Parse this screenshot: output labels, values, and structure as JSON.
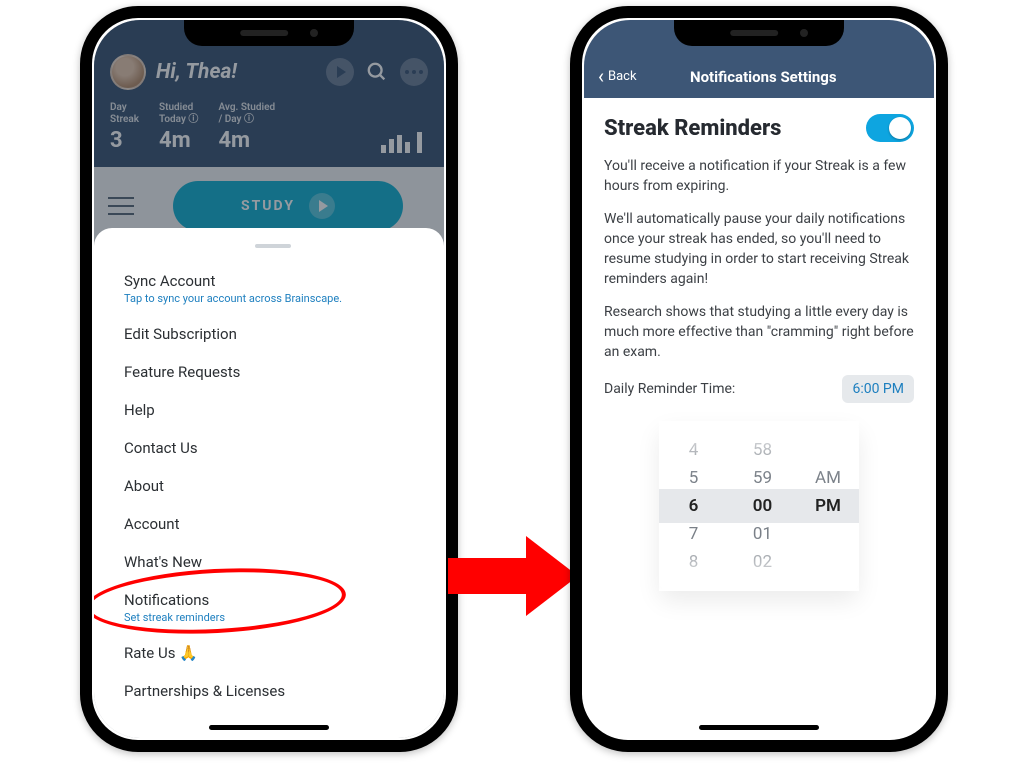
{
  "left": {
    "greeting": "Hi, Thea!",
    "stats": [
      {
        "label": "Day\nStreak",
        "value": "3"
      },
      {
        "label": "Studied\nToday ⓘ",
        "value": "4m"
      },
      {
        "label": "Avg. Studied\n/ Day ⓘ",
        "value": "4m"
      }
    ],
    "study_button": "STUDY",
    "menu": {
      "sync_title": "Sync Account",
      "sync_sub": "Tap to sync your account across Brainscape.",
      "edit_sub": "Edit Subscription",
      "feature_req": "Feature Requests",
      "help": "Help",
      "contact": "Contact Us",
      "about": "About",
      "account": "Account",
      "whats_new": "What's New",
      "notifications_title": "Notifications",
      "notifications_sub": "Set streak reminders",
      "rate": "Rate Us 🙏",
      "partnerships": "Partnerships & Licenses"
    }
  },
  "right": {
    "back": "Back",
    "title": "Notifications Settings",
    "heading": "Streak Reminders",
    "p1": "You'll receive a notification if your Streak is a few hours from expiring.",
    "p2": "We'll automatically pause your daily notifications once your streak has ended, so you'll need to resume studying in order to start receiving Streak reminders again!",
    "p3": "Research shows that studying a little every day is much more effective than \"cramming\" right before an exam.",
    "reminder_label": "Daily Reminder Time:",
    "reminder_value": "6:00 PM",
    "picker": {
      "hours": [
        "4",
        "5",
        "6",
        "7",
        "8"
      ],
      "minutes": [
        "58",
        "59",
        "00",
        "01",
        "02"
      ],
      "ampm": [
        "AM",
        "PM"
      ]
    }
  }
}
